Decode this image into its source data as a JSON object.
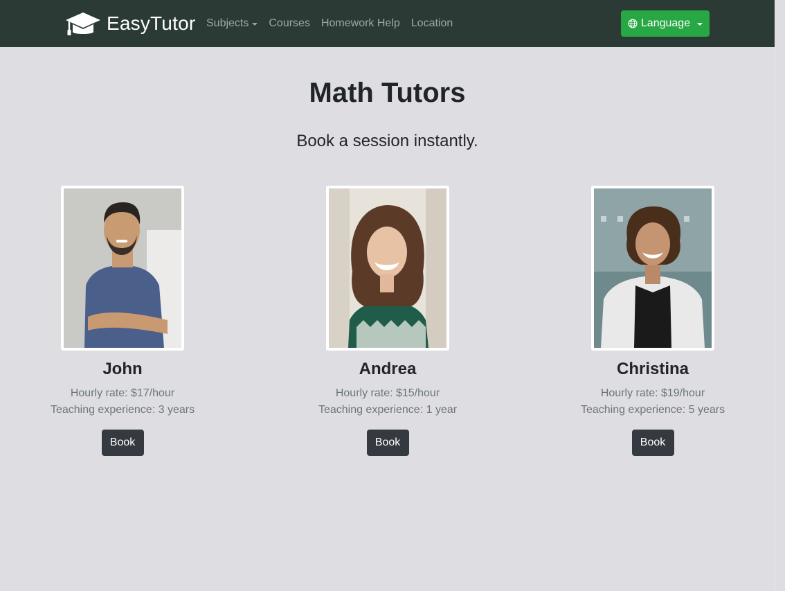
{
  "navbar": {
    "brand": "EasyTutor",
    "brand_icon": "graduation-cap-icon",
    "links": [
      {
        "label": "Subjects",
        "dropdown": true
      },
      {
        "label": "Courses",
        "dropdown": false
      },
      {
        "label": "Homework Help",
        "dropdown": false
      },
      {
        "label": "Location",
        "dropdown": false
      }
    ],
    "language_button": "Language",
    "language_icon": "globe-icon"
  },
  "main": {
    "title": "Math Tutors",
    "subtitle": "Book a session instantly."
  },
  "tutors": [
    {
      "name": "John",
      "rate": "Hourly rate: $17/hour",
      "experience": "Teaching experience: 3 years",
      "book_label": "Book"
    },
    {
      "name": "Andrea",
      "rate": "Hourly rate: $15/hour",
      "experience": "Teaching experience: 1 year",
      "book_label": "Book"
    },
    {
      "name": "Christina",
      "rate": "Hourly rate: $19/hour",
      "experience": "Teaching experience: 5 years",
      "book_label": "Book"
    }
  ],
  "colors": {
    "navbar_bg": "#2b3a34",
    "page_bg": "#dddde2",
    "language_button": "#28a745",
    "book_button": "#343a40",
    "muted_text": "#6c757d"
  }
}
